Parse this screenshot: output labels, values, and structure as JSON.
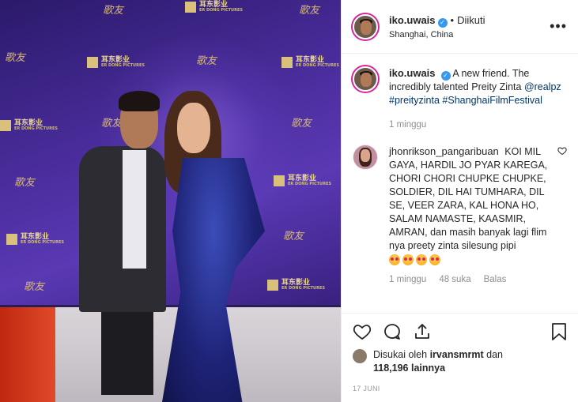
{
  "header": {
    "username": "iko.uwais",
    "follow_status": "Diikuti",
    "location": "Shanghai, China",
    "more_label": "•••"
  },
  "backdrop": {
    "brand_text": "耳东影业",
    "brand_sub": "ER DONG PICTURES"
  },
  "caption": {
    "username": "iko.uwais",
    "text": "A new friend. The incredibly talented Preity Zinta",
    "mention": "@realpz",
    "tags": [
      "#preityzinta",
      "#ShanghaiFilmFestival"
    ],
    "time": "1 minggu"
  },
  "comment": {
    "username": "jhonrikson_pangaribuan",
    "text": "KOI MIL GAYA, HARDIL JO PYAR KAREGA, CHORI CHORI CHUPKE CHUPKE, SOLDIER, DIL HAI TUMHARA, DIL SE, VEER ZARA, KAL HONA HO, SALAM NAMASTE, KAASMIR, AMRAN, dan masih banyak lagi flim nya preety zinta silesung pipi",
    "emoji_count": 4,
    "time": "1 minggu",
    "likes": "48 suka",
    "reply_label": "Balas"
  },
  "likes_line": {
    "prefix": "Disukai oleh",
    "user": "irvansmrmt",
    "connector": "dan",
    "count": "118,196",
    "suffix": "lainnya"
  },
  "date": "17 JUNI",
  "icons": [
    "heart-icon",
    "comment-icon",
    "share-icon",
    "bookmark-icon"
  ]
}
